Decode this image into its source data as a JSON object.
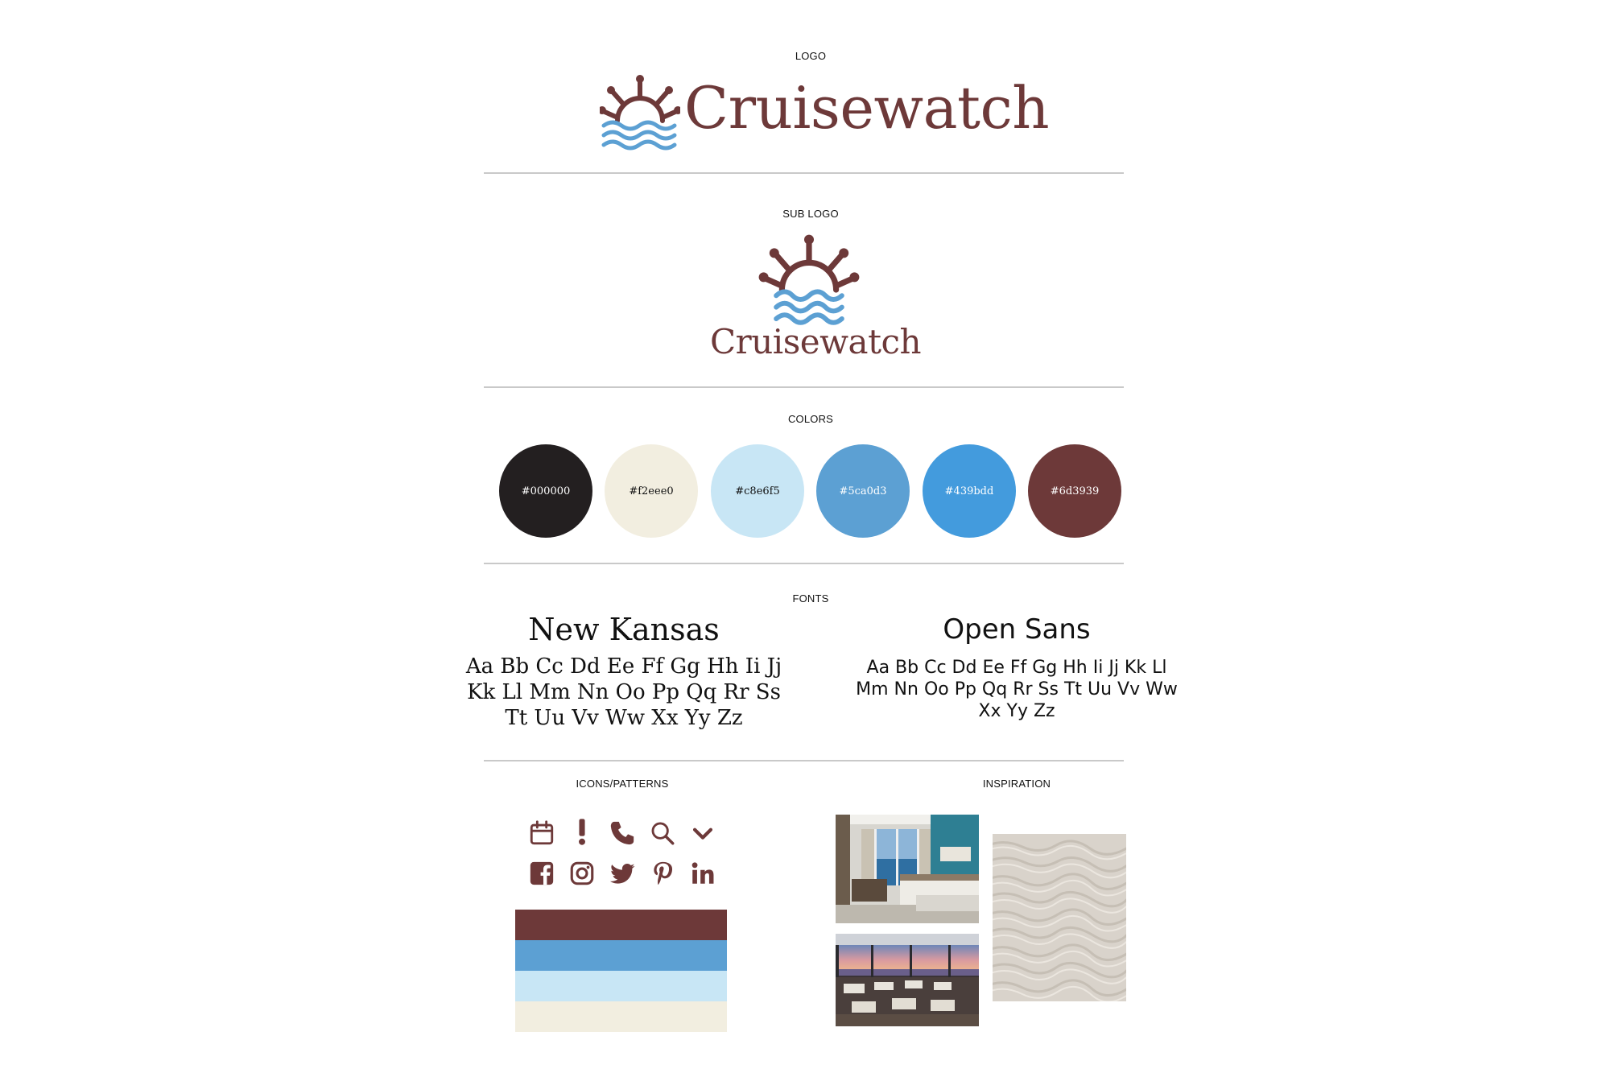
{
  "sections": {
    "logo": "LOGO",
    "sub_logo": "SUB LOGO",
    "colors": "COLORS",
    "fonts": "FONTS",
    "icons": "ICONS/PATTERNS",
    "inspiration": "INSPIRATION"
  },
  "brand": {
    "name": "Cruisewatch",
    "sub_name": "Cruisewatch"
  },
  "colors": [
    "#000000",
    "#f2eee0",
    "#c8e6f5",
    "#5ca0d3",
    "#439bdd",
    "#6d3939"
  ],
  "fonts": {
    "primary": {
      "name": "New Kansas",
      "sample": "Aa Bb Cc Dd Ee Ff Gg Hh Ii Jj Kk Ll Mm Nn Oo Pp Qq Rr Ss Tt Uu Vv Ww Xx Yy Zz"
    },
    "secondary": {
      "name": "Open Sans",
      "sample": "Aa Bb Cc Dd Ee Ff Gg Hh Ii Jj Kk Ll Mm Nn Oo Pp Qq Rr Ss Tt Uu Vv Ww Xx Yy Zz"
    }
  },
  "icons": [
    "calendar-icon",
    "exclamation-icon",
    "phone-icon",
    "search-icon",
    "chevron-down-icon",
    "facebook-icon",
    "instagram-icon",
    "twitter-icon",
    "pinterest-icon",
    "linkedin-icon"
  ],
  "pattern_colors": [
    "#6d3939",
    "#5ca0d3",
    "#c8e6f5",
    "#f2eee0"
  ]
}
